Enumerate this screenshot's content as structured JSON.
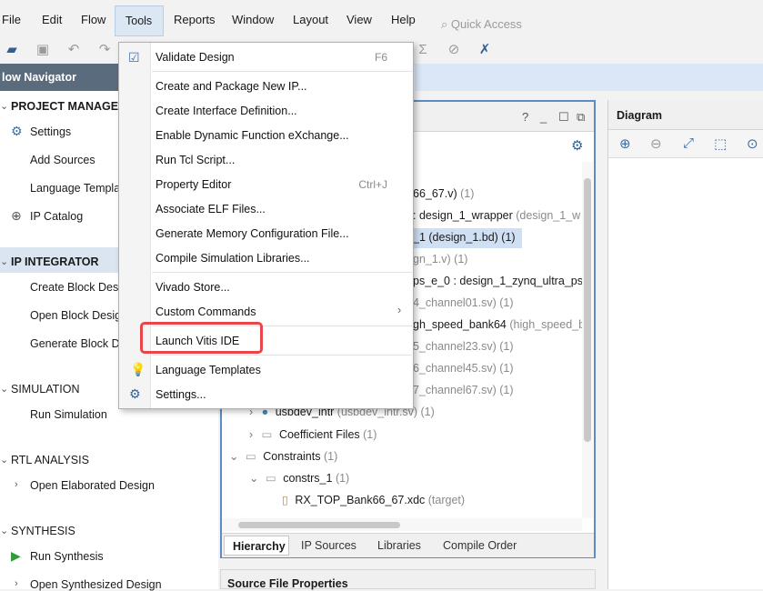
{
  "window": {
    "title_fragment": "[...]"
  },
  "menubar": {
    "items": [
      "File",
      "Edit",
      "Flow",
      "Tools",
      "Reports",
      "Window",
      "Layout",
      "View",
      "Help"
    ],
    "quick_access_placeholder": "Quick Access"
  },
  "flow_navigator": {
    "title": "low Navigator",
    "sections": {
      "project_manager": "PROJECT MANAGER",
      "settings": "Settings",
      "add_sources": "Add Sources",
      "language_templates": "Language Templa",
      "ip_catalog": "IP Catalog",
      "ip_integrator": "IP INTEGRATOR",
      "create_block": "Create Block Desi",
      "open_block": "Open Block Desig",
      "generate_block": "Generate Block D",
      "simulation": "SIMULATION",
      "run_simulation": "Run Simulation",
      "rtl_analysis": "RTL ANALYSIS",
      "open_elaborated": "Open Elaborated Design",
      "synthesis": "SYNTHESIS",
      "run_synthesis": "Run Synthesis",
      "open_synthesized": "Open Synthesized Design"
    }
  },
  "sources": {
    "rows": [
      {
        "main": "66_67.v)",
        "dim": " (1)"
      },
      {
        "main": ": design_1_wrapper",
        "dim": " (design_1_w"
      },
      {
        "main": "_1 (design_1.bd) (1)",
        "dim": ""
      },
      {
        "main": "",
        "dim": "gn_1.v) (1)"
      },
      {
        "main": "ps_e_0 : design_1_zynq_ultra_ps",
        "dim": ""
      },
      {
        "main": "",
        "dim": "4_channel01.sv) (1)"
      },
      {
        "main": "gh_speed_bank64",
        "dim": " (high_speed_b"
      },
      {
        "main": "",
        "dim": "5_channel23.sv) (1)"
      },
      {
        "main": "",
        "dim": "6_channel45.sv) (1)"
      },
      {
        "main": "",
        "dim": "7_channel67.sv) (1)"
      },
      {
        "main": "usbdev_intr",
        "dim": " (usbdev_intr.sv) (1)"
      },
      {
        "main": "Coefficient Files",
        "dim": " (1)"
      },
      {
        "main": "Constraints",
        "dim": " (1)"
      },
      {
        "main": "constrs_1",
        "dim": " (1)"
      },
      {
        "main": "RX_TOP_Bank66_67.xdc",
        "dim": " (target)"
      }
    ],
    "tabs": [
      "Hierarchy",
      "IP Sources",
      "Libraries",
      "Compile Order"
    ]
  },
  "diagram": {
    "title": "Diagram"
  },
  "source_file_properties": {
    "title": "Source File Properties"
  },
  "tools_menu": {
    "items": [
      {
        "label": "Validate Design",
        "shortcut": "F6",
        "icon": "validate-check-icon"
      },
      {
        "label": "Create and Package New IP..."
      },
      {
        "label": "Create Interface Definition..."
      },
      {
        "label": "Enable Dynamic Function eXchange..."
      },
      {
        "label": "Run Tcl Script..."
      },
      {
        "label": "Property Editor",
        "shortcut": "Ctrl+J"
      },
      {
        "label": "Associate ELF Files..."
      },
      {
        "label": "Generate Memory Configuration File..."
      },
      {
        "label": "Compile Simulation Libraries..."
      },
      {
        "label": "Vivado Store..."
      },
      {
        "label": "Custom Commands",
        "submenu": "›"
      },
      {
        "label": "Launch Vitis IDE"
      },
      {
        "label": "Language Templates",
        "icon": "lightbulb-icon"
      },
      {
        "label": "Settings...",
        "icon": "gear-icon"
      }
    ]
  },
  "colors": {
    "highlight": "#e8464a",
    "selection": "#cfe0f5",
    "accent": "#5b8dc4"
  }
}
